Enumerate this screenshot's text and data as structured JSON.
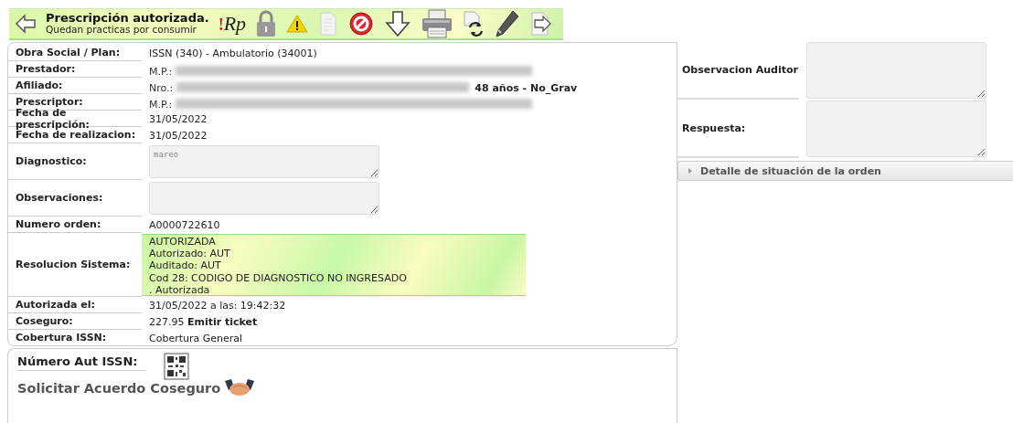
{
  "toolbar": {
    "title": "Prescripción autorizada.",
    "subtitle": "Quedan practicas por consumir",
    "rp_mark": "!",
    "rp_label": "Rp",
    "icons": [
      {
        "kind": "back"
      },
      {
        "kind": "rp"
      },
      {
        "kind": "lock"
      },
      {
        "kind": "warning"
      },
      {
        "kind": "document"
      },
      {
        "kind": "forbidden"
      },
      {
        "kind": "down"
      },
      {
        "kind": "printer"
      },
      {
        "kind": "refresh"
      },
      {
        "kind": "pencil"
      },
      {
        "kind": "forward"
      }
    ]
  },
  "details": {
    "rows": [
      {
        "label": "Obra Social / Plan:",
        "kind": "text",
        "value": "ISSN (340) - Ambulatorio (34001)"
      },
      {
        "label": "Prestador:",
        "kind": "redacted",
        "prefix": "M.P.:"
      },
      {
        "label": "Afiliado:",
        "kind": "redacted",
        "prefix": "Nro.:",
        "suffix": "48 años - No_Grav"
      },
      {
        "label": "Prescriptor:",
        "kind": "redacted",
        "prefix": "M.P.:"
      },
      {
        "label": "Fecha de prescripción:",
        "kind": "text",
        "value": "31/05/2022"
      },
      {
        "label": "Fecha de realizacion:",
        "kind": "text",
        "value": "31/05/2022"
      },
      {
        "label": "Diagnostico:",
        "kind": "textarea",
        "value": "mareo"
      },
      {
        "label": "Observaciones:",
        "kind": "textarea"
      },
      {
        "label": "Numero orden:",
        "kind": "text",
        "value": "A0000722610"
      },
      {
        "label": "Resolucion Sistema:",
        "kind": "status",
        "lines": [
          "AUTORIZADA",
          "Autorizado: AUT",
          "Auditado: AUT",
          "Cod 28: CODIGO DE DIAGNOSTICO NO INGRESADO",
          ". Autorizada"
        ]
      },
      {
        "label": "Autorizada el:",
        "kind": "text",
        "value": "31/05/2022 a las: 19:42:32"
      },
      {
        "label": "Coseguro:",
        "kind": "link",
        "value": "227.95",
        "link": "Emitir ticket"
      },
      {
        "label": "Cobertura ISSN:",
        "kind": "text",
        "value": "Cobertura General"
      }
    ]
  },
  "bottom": {
    "aut_label": "Número Aut ISSN:",
    "acuerdo_label": "Solicitar Acuerdo Coseguro"
  },
  "side": {
    "fields": [
      {
        "label": "Observacion Auditor"
      },
      {
        "label": "Respuesta:"
      }
    ],
    "accordion": {
      "title": "Detalle de situación de la orden",
      "expanded": false
    }
  }
}
